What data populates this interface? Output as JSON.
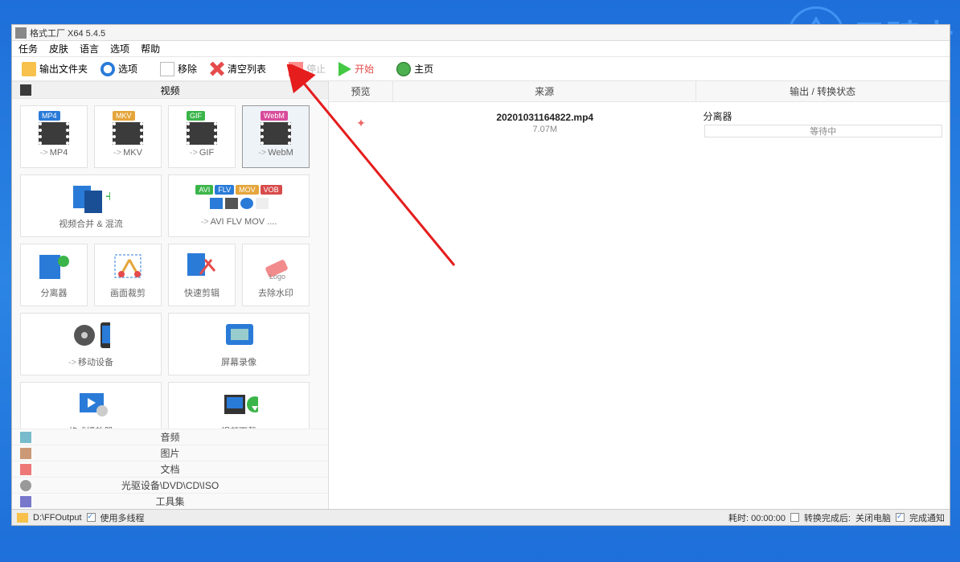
{
  "watermark": {
    "text": "云骑士"
  },
  "window": {
    "title": "格式工厂 X64 5.4.5"
  },
  "menu": {
    "task": "任务",
    "skin": "皮肤",
    "lang": "语言",
    "options": "选项",
    "help": "帮助"
  },
  "toolbar": {
    "output_folder": "输出文件夹",
    "options": "选项",
    "remove": "移除",
    "clear_list": "清空列表",
    "stop": "停止",
    "start": "开始",
    "home": "主页"
  },
  "categories": {
    "video": "视频",
    "audio": "音频",
    "picture": "图片",
    "document": "文档",
    "rom": "光驱设备\\DVD\\CD\\ISO",
    "toolbox": "工具集"
  },
  "tiles": {
    "mp4": "MP4",
    "mkv": "MKV",
    "gif": "GIF",
    "webm": "WebM",
    "merge": "视频合并 & 混流",
    "avi_more": "AVI FLV MOV ....",
    "splitter": "分离器",
    "crop": "画面裁剪",
    "quick_cut": "快速剪辑",
    "watermark_remove": "去除水印",
    "mobile": "移动设备",
    "screen_rec": "屏幕录像",
    "player": "格式播放器",
    "video_dl": "视频下载",
    "badge_mp4": "MP4",
    "badge_mkv": "MKV",
    "badge_gif": "GIF",
    "badge_webm": "WebM",
    "badge_avi": "AVI",
    "badge_flv": "FLV",
    "badge_mov": "MOV",
    "badge_vob": "VOB"
  },
  "columns": {
    "preview": "预览",
    "source": "来源",
    "output": "输出 / 转换状态"
  },
  "task": {
    "source_name": "20201031164822.mp4",
    "source_size": "7.07M",
    "output_name": "分离器",
    "status": "等待中"
  },
  "statusbar": {
    "path": "D:\\FFOutput",
    "multithread": "使用多线程",
    "elapsed": "耗时: 00:00:00",
    "after_done": "转换完成后:",
    "shutdown": "关闭电脑",
    "notify": "完成通知"
  }
}
